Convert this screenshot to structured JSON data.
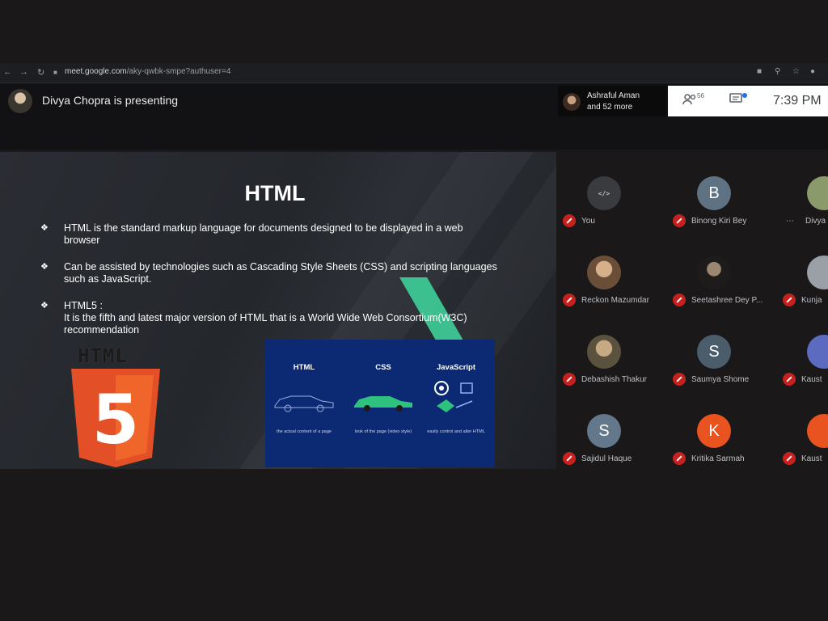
{
  "browser": {
    "url_host": "meet.google.com",
    "url_path": "/aky-qwbk-smpe?authuser=4"
  },
  "meet": {
    "presenter_text": "Divya Chopra is presenting",
    "participant_chip": {
      "line1": "Ashraful Aman",
      "line2": "and 52 more"
    },
    "people_count": "56",
    "time": "7:39 PM"
  },
  "slide": {
    "title": "HTML",
    "bullets": [
      {
        "text": "HTML is the standard markup language for documents designed to be displayed in a web browser"
      },
      {
        "text": "Can be assisted by technologies such as Cascading Style Sheets (CSS) and scripting languages such as JavaScript."
      },
      {
        "text": "HTML5 :\nIt is the fifth and latest major version of HTML that is a World Wide Web Consortium(W3C) recommendation"
      }
    ],
    "logo_word": "HTML",
    "logo_number": "5",
    "cards": [
      {
        "heading": "HTML",
        "caption": "the actual content of a page"
      },
      {
        "heading": "CSS",
        "caption": "look of the page (video style)"
      },
      {
        "heading": "JavaScript",
        "caption": "easily control and alter HTML"
      }
    ]
  },
  "participants": [
    {
      "name": "You",
      "initial": "",
      "avatar": "coding-logo",
      "color": "#3c4043"
    },
    {
      "name": "Binong Kiri Bey",
      "initial": "B",
      "avatar": "letter",
      "color": "#5f7283"
    },
    {
      "name": "Divya",
      "initial": "",
      "avatar": "photo",
      "color": "#8a9a6a"
    },
    {
      "name": "Reckon Mazumdar",
      "initial": "",
      "avatar": "photo",
      "color": "#b08a68"
    },
    {
      "name": "Seetashree Dey P...",
      "initial": "",
      "avatar": "photo",
      "color": "#2d2a26"
    },
    {
      "name": "Kunja",
      "initial": "",
      "avatar": "photo",
      "color": "#9aa0a6"
    },
    {
      "name": "Debashish Thakur",
      "initial": "",
      "avatar": "photo",
      "color": "#8a7c62"
    },
    {
      "name": "Saumya Shome",
      "initial": "S",
      "avatar": "letter",
      "color": "#4b5c6b"
    },
    {
      "name": "Kaust",
      "initial": "",
      "avatar": "letter",
      "color": "#5c6bc0"
    },
    {
      "name": "Sajidul Haque",
      "initial": "S",
      "avatar": "letter",
      "color": "#63788a"
    },
    {
      "name": "Kritika Sarmah",
      "initial": "K",
      "avatar": "letter",
      "color": "#e8531f"
    },
    {
      "name": "Kaust",
      "initial": "",
      "avatar": "letter",
      "color": "#e8531f"
    }
  ]
}
